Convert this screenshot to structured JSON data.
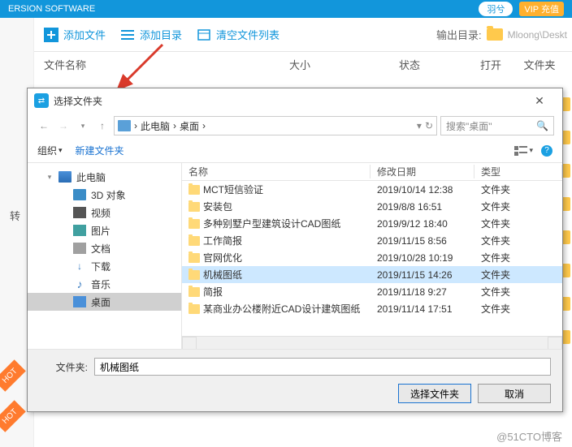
{
  "bg": {
    "title": "ERSION SOFTWARE",
    "account": "羽兮",
    "vip": "VIP 充值",
    "toolbar": {
      "add_file": "添加文件",
      "add_dir": "添加目录",
      "clear_list": "清空文件列表",
      "output_label": "输出目录:",
      "output_path": "Mloong\\Deskt"
    },
    "columns": {
      "name": "文件名称",
      "size": "大小",
      "status": "状态",
      "open": "打开",
      "folder": "文件夹"
    },
    "left_label": "转",
    "hot": "HOT"
  },
  "dialog": {
    "title": "选择文件夹",
    "breadcrumb": {
      "root": "此电脑",
      "sep": "›",
      "leaf": "桌面"
    },
    "search_placeholder": "搜索\"桌面\"",
    "toolbar": {
      "organize": "组织",
      "newfolder": "新建文件夹"
    },
    "tree": [
      {
        "label": "此电脑",
        "icon": "ico-pc",
        "exp": "▾",
        "indent": false,
        "sel": false
      },
      {
        "label": "3D 对象",
        "icon": "ico-3d",
        "exp": "",
        "indent": true,
        "sel": false
      },
      {
        "label": "视频",
        "icon": "ico-video",
        "exp": "",
        "indent": true,
        "sel": false
      },
      {
        "label": "图片",
        "icon": "ico-pic",
        "exp": "",
        "indent": true,
        "sel": false
      },
      {
        "label": "文档",
        "icon": "ico-doc",
        "exp": "",
        "indent": true,
        "sel": false
      },
      {
        "label": "下载",
        "icon": "ico-dl",
        "exp": "",
        "indent": true,
        "sel": false
      },
      {
        "label": "音乐",
        "icon": "ico-music",
        "exp": "",
        "indent": true,
        "sel": false
      },
      {
        "label": "桌面",
        "icon": "ico-desk",
        "exp": "",
        "indent": true,
        "sel": true
      }
    ],
    "list_head": {
      "name": "名称",
      "date": "修改日期",
      "type": "类型"
    },
    "files": [
      {
        "name": "MCT短信验证",
        "date": "2019/10/14 12:38",
        "type": "文件夹",
        "sel": false
      },
      {
        "name": "安装包",
        "date": "2019/8/8 16:51",
        "type": "文件夹",
        "sel": false
      },
      {
        "name": "多种别墅户型建筑设计CAD图纸",
        "date": "2019/9/12 18:40",
        "type": "文件夹",
        "sel": false
      },
      {
        "name": "工作简报",
        "date": "2019/11/15 8:56",
        "type": "文件夹",
        "sel": false
      },
      {
        "name": "官网优化",
        "date": "2019/10/28 10:19",
        "type": "文件夹",
        "sel": false
      },
      {
        "name": "机械图纸",
        "date": "2019/11/15 14:26",
        "type": "文件夹",
        "sel": true
      },
      {
        "name": "简报",
        "date": "2019/11/18 9:27",
        "type": "文件夹",
        "sel": false
      },
      {
        "name": "某商业办公楼附近CAD设计建筑图纸",
        "date": "2019/11/14 17:51",
        "type": "文件夹",
        "sel": false
      }
    ],
    "footer": {
      "label": "文件夹:",
      "value": "机械图纸",
      "select": "选择文件夹",
      "cancel": "取消"
    }
  },
  "watermark": "@51CTO博客"
}
